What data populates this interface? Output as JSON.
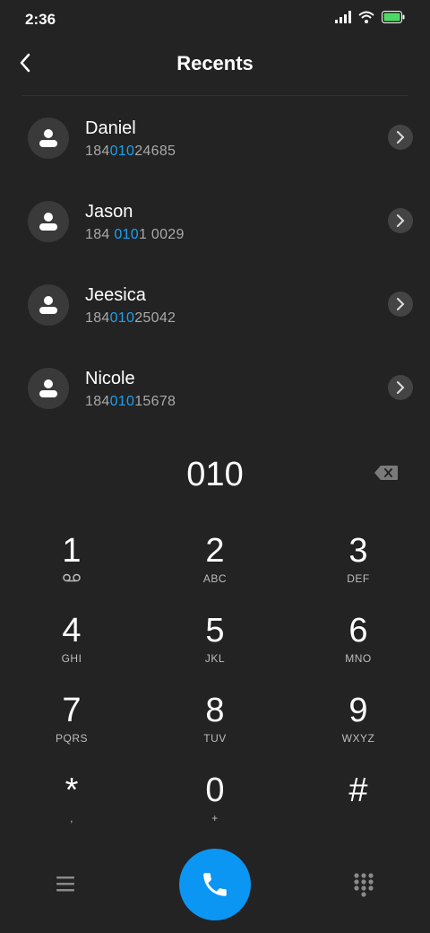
{
  "status": {
    "time": "2:36"
  },
  "header": {
    "title": "Recents"
  },
  "contacts": [
    {
      "name": "Daniel",
      "num_pre": "184",
      "num_hl": "010",
      "num_post": "24685"
    },
    {
      "name": "Jason",
      "num_pre": "184 ",
      "num_hl": "010",
      "num_post": "1 0029"
    },
    {
      "name": "Jeesica",
      "num_pre": "184",
      "num_hl": "010",
      "num_post": "25042"
    },
    {
      "name": "Nicole",
      "num_pre": "184",
      "num_hl": "010",
      "num_post": "15678"
    }
  ],
  "dial": {
    "entered": "010"
  },
  "keys": [
    {
      "digit": "1",
      "letters": ""
    },
    {
      "digit": "2",
      "letters": "ABC"
    },
    {
      "digit": "3",
      "letters": "DEF"
    },
    {
      "digit": "4",
      "letters": "GHI"
    },
    {
      "digit": "5",
      "letters": "JKL"
    },
    {
      "digit": "6",
      "letters": "MNO"
    },
    {
      "digit": "7",
      "letters": "PQRS"
    },
    {
      "digit": "8",
      "letters": "TUV"
    },
    {
      "digit": "9",
      "letters": "WXYZ"
    },
    {
      "digit": "*",
      "letters": ","
    },
    {
      "digit": "0",
      "letters": "+"
    },
    {
      "digit": "#",
      "letters": ""
    }
  ],
  "colors": {
    "background": "#232323",
    "accent": "#0b96f3",
    "highlight": "#1aa0f0",
    "battery": "#4cd964"
  },
  "icons": {
    "voicemail": "voicemail-icon",
    "backspace": "backspace-icon",
    "call": "phone-icon",
    "menu": "menu-icon",
    "dialpad": "dialpad-icon"
  }
}
